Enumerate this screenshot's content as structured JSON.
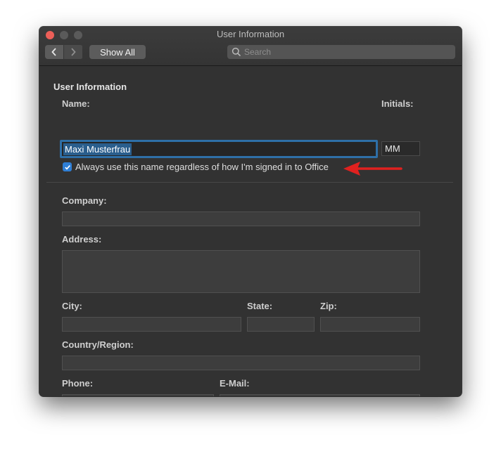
{
  "window": {
    "title": "User Information"
  },
  "toolbar": {
    "back_icon": "chevron-left-icon",
    "forward_icon": "chevron-right-icon",
    "show_all_label": "Show All",
    "search_placeholder": "Search"
  },
  "form": {
    "section_title": "User Information",
    "name_label": "Name:",
    "name_value": "Maxi Musterfrau",
    "initials_label": "Initials:",
    "initials_value": "MM",
    "always_use_label": "Always use this name regardless of how I'm signed in to Office",
    "always_use_checked": true,
    "company_label": "Company:",
    "address_label": "Address:",
    "city_label": "City:",
    "state_label": "State:",
    "zip_label": "Zip:",
    "country_label": "Country/Region:",
    "phone_label": "Phone:",
    "email_label": "E-Mail:"
  },
  "colors": {
    "accent": "#2f7fd6",
    "annotation_arrow": "#e0211f",
    "window_bg": "#323232"
  }
}
